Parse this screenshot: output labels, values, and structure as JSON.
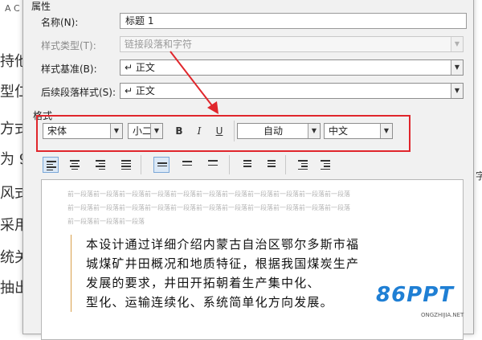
{
  "background_doc": {
    "top_mark": "A C",
    "lines": [
      "持他",
      "型仁",
      "方式",
      "为 9",
      "风式",
      "采用",
      "统关",
      "抽出"
    ],
    "right_char": "字"
  },
  "dialog": {
    "section_properties": "属性",
    "name_label": "名称(N):",
    "name_value": "标题 1",
    "style_type_label": "样式类型(T):",
    "style_type_value": "链接段落和字符",
    "style_based_label": "样式基准(B):",
    "style_based_value": "↵ 正文",
    "next_para_label": "后续段落样式(S):",
    "next_para_value": "↵ 正文",
    "section_format": "格式",
    "format": {
      "font": "宋体",
      "size": "小二",
      "bold": "B",
      "italic": "I",
      "underline": "U",
      "color": "自动",
      "language": "中文"
    },
    "preview": {
      "gray_lines": [
        "前一段落前一段落前一段落前一段落前一段落前一段落前一段落前一段落前一段落前一段落前一段落",
        "前一段落前一段落前一段落前一段落前一段落前一段落前一段落前一段落前一段落前一段落前一段落",
        "前一段落前一段落前一段落"
      ],
      "text_lines": [
        "本设计通过详细介绍内蒙古自治区鄂尔多斯市福",
        "城煤矿井田概况和地质特征，根据我国煤炭生产",
        "发展的要求，井田开拓朝着生产集中化、",
        "型化、运输连续化、系统简单化方向发展。"
      ]
    }
  },
  "watermark": {
    "logo": "86PPT",
    "site": "ONGZHIJIA.NET"
  },
  "colors": {
    "highlight_box": "#e0262c",
    "arrow": "#e0262c",
    "watermark": "#1f7fd4"
  }
}
